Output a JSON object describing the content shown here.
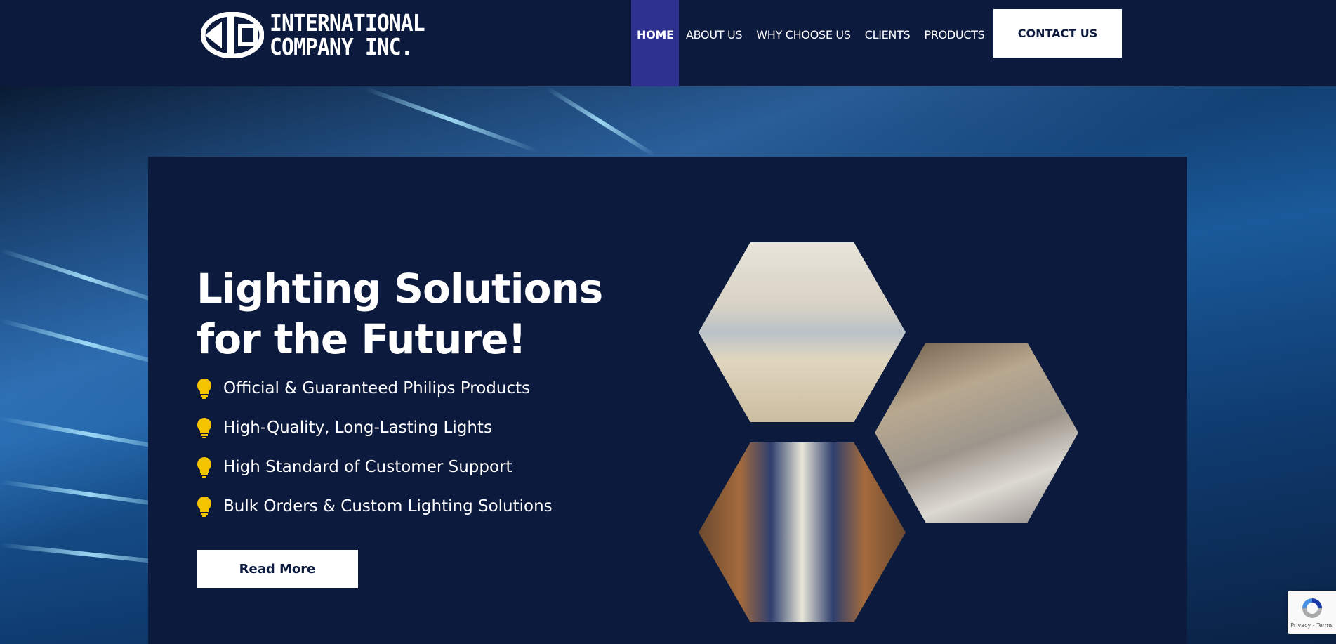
{
  "header": {
    "logo_text_line1": "INTERNATIONAL",
    "logo_text_line2": "COMPANY INC.",
    "nav": [
      "HOME",
      "ABOUT US",
      "WHY CHOOSE US",
      "CLIENTS",
      "PRODUCTS"
    ],
    "active_nav": "HOME",
    "contact_label": "CONTACT US"
  },
  "hero": {
    "title_line1": "Lighting Solutions",
    "title_line2": "for the Future!",
    "features": [
      "Official & Guaranteed Philips Products",
      "High-Quality, Long-Lasting Lights",
      "High Standard of Customer Support",
      "Bulk Orders & Custom Lighting Solutions"
    ],
    "feature_icon": "lightbulb-icon",
    "read_more_label": "Read More",
    "images": [
      "office-interior",
      "living-room-interior",
      "warehouse-interior"
    ]
  },
  "recaptcha": {
    "label": "Privacy - Terms"
  },
  "colors": {
    "navy": "#0c1a3d",
    "active_nav": "#2e3190",
    "bulb": "#f5c400",
    "white": "#ffffff"
  }
}
